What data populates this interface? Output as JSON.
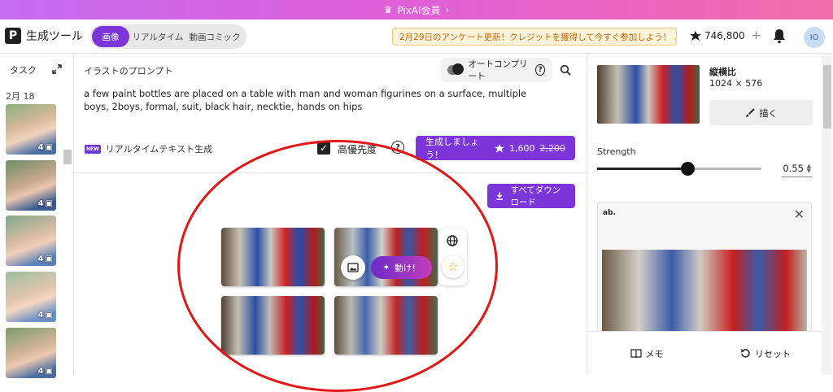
{
  "banner": {
    "text": "PixAI会員",
    "arrow": "›"
  },
  "header": {
    "logo_letter": "P",
    "app_title": "生成ツール",
    "tabs": [
      {
        "label": "画像",
        "active": true
      },
      {
        "label": "リアルタイム",
        "active": false
      },
      {
        "label": "動画コミック",
        "active": false
      }
    ],
    "announcement": "2月29日のアンケート更新！クレジットを獲得して今すぐ参加しよう！",
    "announcement_arrow": "›",
    "credits": "746,800",
    "credits_plus": "+",
    "avatar_initials": "IO"
  },
  "tasks": {
    "heading": "タスク",
    "date": "2月 18",
    "items": [
      {
        "count": "4"
      },
      {
        "count": "4"
      },
      {
        "count": "4"
      },
      {
        "count": "4"
      },
      {
        "count": "4"
      }
    ]
  },
  "prompt": {
    "title": "イラストのプロンプト",
    "autocomplete_label": "オートコンプリート",
    "text": "a few paint bottles are placed on a table with man and woman figurines on a surface, multiple boys, 2boys, formal, suit, black hair, necktie, hands on hips",
    "new_badge": "NEW",
    "realtime_label": "リアルタイムテキスト生成",
    "hq_label": "高優先度",
    "generate_label": "生成しましょう！",
    "cost_new": "1,600",
    "cost_old": "2,200"
  },
  "results": {
    "download_label": "すべてダウンロード",
    "move_label": "動け！"
  },
  "right_panel": {
    "aspect_label": "縦横比",
    "aspect_value": "1024 × 576",
    "draw_label": "描く",
    "strength_label": "Strength",
    "strength_value": "0.55",
    "strength_fraction": 0.55,
    "preview_badge": "ab.",
    "memo_label": "メモ",
    "reset_label": "リセット"
  },
  "colors": {
    "accent": "#7b35d8",
    "annotation": "#e01818",
    "announcement_text": "#c46a00"
  }
}
